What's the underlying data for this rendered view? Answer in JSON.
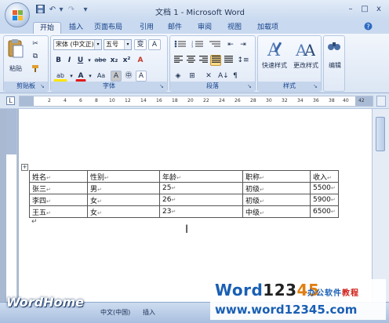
{
  "window": {
    "title": "文档 1 - Microsoft Word",
    "minimize": "–",
    "maximize": "□",
    "close": "x"
  },
  "quick_access": {
    "undo": "↶",
    "redo": "↷",
    "more": "▾"
  },
  "tabs": [
    "开始",
    "插入",
    "页面布局",
    "引用",
    "邮件",
    "审阅",
    "视图",
    "加载项"
  ],
  "ribbon": {
    "clipboard": {
      "label": "剪贴板",
      "paste": "粘贴"
    },
    "font": {
      "label": "字体",
      "font_name": "宋体 (中文正)",
      "font_size": "五号",
      "wen": "变",
      "a_box": "A",
      "bold": "B",
      "italic": "I",
      "underline": "U",
      "strike": "abe",
      "subscript": "x₂",
      "superscript": "x²",
      "clear": "A",
      "highlight": "ab",
      "font_color": "A",
      "case": "Aa",
      "char_shade": "A",
      "enclose": "㊥",
      "char_border": "A"
    },
    "paragraph": {
      "label": "段落"
    },
    "styles": {
      "label": "样式",
      "quick": "快速样式",
      "change": "更改样式"
    },
    "editing": {
      "label": "编辑"
    }
  },
  "ruler": {
    "corner": "L",
    "ticks": [
      "2",
      "4",
      "6",
      "8",
      "10",
      "12",
      "14",
      "16",
      "18",
      "20",
      "22",
      "24",
      "26",
      "28",
      "30",
      "32",
      "34",
      "36",
      "38",
      "40",
      "42"
    ]
  },
  "table": {
    "rows": [
      [
        "姓名",
        "性别",
        "年龄",
        "职称",
        "收入"
      ],
      [
        "张三",
        "男",
        "25",
        "初级",
        "5500"
      ],
      [
        "李四",
        "女",
        "26",
        "初级",
        "5900"
      ],
      [
        "王五",
        "女",
        "23",
        "中级",
        "6500"
      ]
    ]
  },
  "status": {
    "language": "中文(中国)",
    "mode": "插入"
  },
  "watermarks": {
    "wordhome": "WordHome",
    "brand_word": "Word",
    "brand_num1": "123",
    "brand_num2": "45",
    "tag_a": "办公软件",
    "tag_b": "教程",
    "url": "www.word12345.com"
  }
}
